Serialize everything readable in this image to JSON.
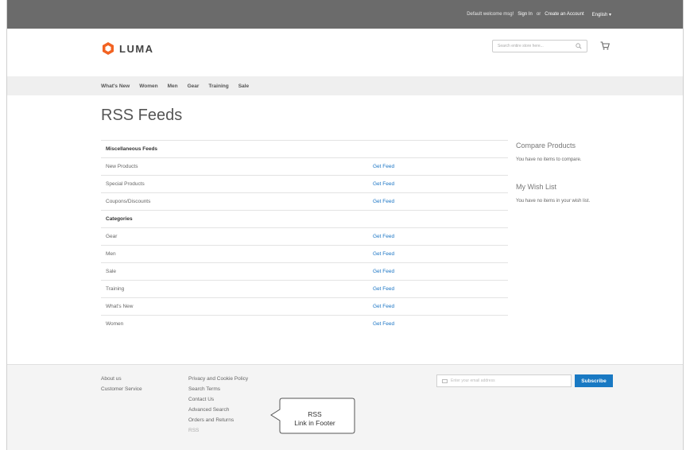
{
  "topbar": {
    "welcome": "Default welcome msg!",
    "sign_in": "Sign In",
    "or": "or",
    "create_account": "Create an Account",
    "language": "English"
  },
  "header": {
    "logo_text": "LUMA",
    "search_placeholder": "Search entire store here..."
  },
  "nav": {
    "items": [
      "What's New",
      "Women",
      "Men",
      "Gear",
      "Training",
      "Sale"
    ]
  },
  "page": {
    "title": "RSS Feeds"
  },
  "feeds": {
    "misc_heading": "Miscellaneous Feeds",
    "misc": [
      {
        "name": "New Products",
        "link": "Get Feed"
      },
      {
        "name": "Special Products",
        "link": "Get Feed"
      },
      {
        "name": "Coupons/Discounts",
        "link": "Get Feed"
      }
    ],
    "categories_heading": "Categories",
    "categories": [
      {
        "name": "Gear",
        "link": "Get Feed"
      },
      {
        "name": "Men",
        "link": "Get Feed"
      },
      {
        "name": "Sale",
        "link": "Get Feed"
      },
      {
        "name": "Training",
        "link": "Get Feed"
      },
      {
        "name": "What's New",
        "link": "Get Feed"
      },
      {
        "name": "Women",
        "link": "Get Feed"
      }
    ]
  },
  "sidebar": {
    "compare_title": "Compare Products",
    "compare_text": "You have no items to compare.",
    "wishlist_title": "My Wish List",
    "wishlist_text": "You have no items in your wish list."
  },
  "footer": {
    "col1": [
      "About us",
      "Customer Service"
    ],
    "col2": [
      "Privacy and Cookie Policy",
      "Search Terms",
      "Contact Us",
      "Advanced Search",
      "Orders and Returns",
      "RSS"
    ],
    "newsletter_placeholder": "Enter your email address",
    "subscribe_label": "Subscribe"
  },
  "callout": {
    "line1": "RSS",
    "line2": "Link in Footer"
  },
  "colors": {
    "topbar": "#6b6b6b",
    "link": "#1a74c4",
    "brand_orange": "#f26322",
    "subscribe": "#1979c3"
  }
}
